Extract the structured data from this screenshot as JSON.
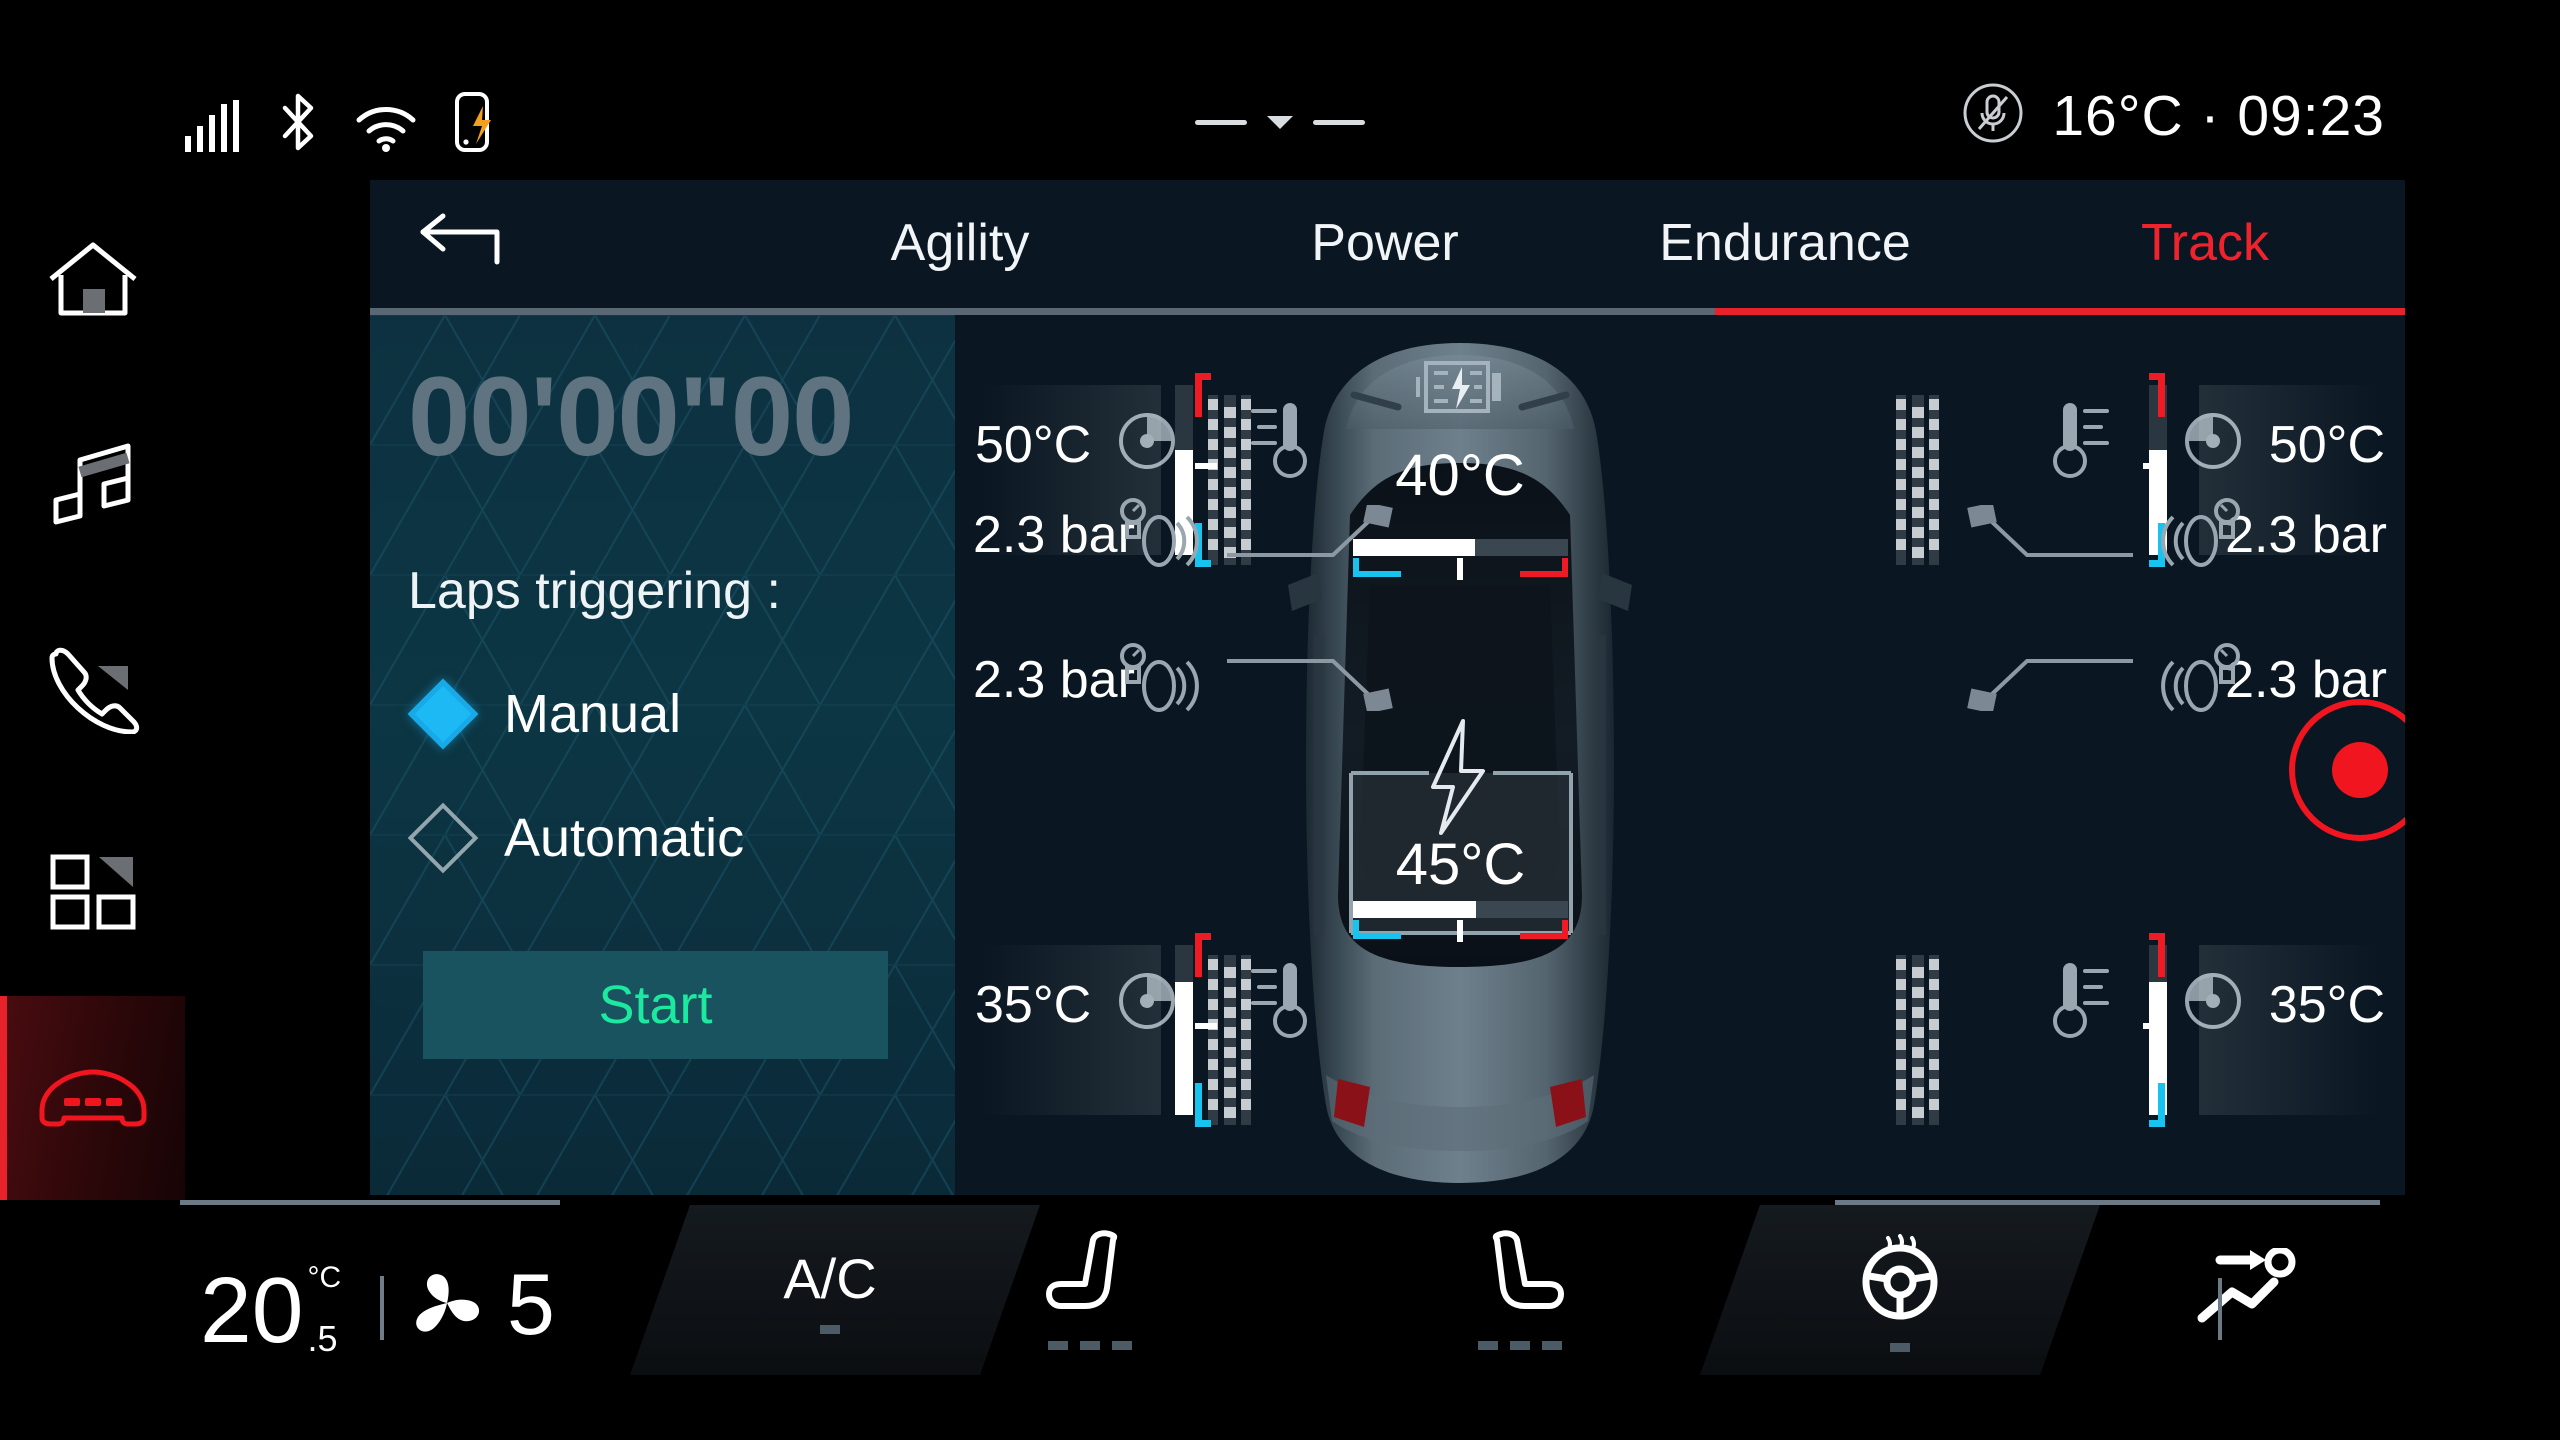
{
  "status_bar": {
    "icons_left": [
      "signal-bars-icon",
      "bluetooth-icon",
      "wifi-icon",
      "phone-charging-icon"
    ],
    "center_handle": "drag-handle",
    "mic_icon": "microphone-muted-icon",
    "outside_temp": "16°C",
    "separator": "·",
    "clock": "09:23",
    "info_text": "16°C · 09:23"
  },
  "sidebar": {
    "items": [
      {
        "name": "home",
        "icon": "home-icon",
        "active": false
      },
      {
        "name": "media",
        "icon": "music-note-icon",
        "active": false
      },
      {
        "name": "phone",
        "icon": "phone-handset-icon",
        "active": false
      },
      {
        "name": "apps",
        "icon": "apps-grid-icon",
        "active": false
      },
      {
        "name": "vehicle",
        "icon": "car-icon",
        "active": true
      }
    ]
  },
  "header": {
    "back_icon": "back-arrow-icon",
    "tabs": [
      {
        "label": "Agility",
        "active": false
      },
      {
        "label": "Power",
        "active": false
      },
      {
        "label": "Endurance",
        "active": false
      },
      {
        "label": "Track",
        "active": true
      }
    ],
    "active_tab": "Track",
    "accent_color": "#e8222a",
    "underline_inactive_color": "#5a6775"
  },
  "timer_panel": {
    "lap_time": "00'00\"00",
    "laps_label": "Laps triggering :",
    "options": [
      {
        "label": "Manual",
        "selected": true
      },
      {
        "label": "Automatic",
        "selected": false
      }
    ],
    "start_button": "Start",
    "selected_color": "#1cb9f5",
    "start_text_color": "#1ce8a0",
    "panel_color": "#0d3140"
  },
  "vehicle": {
    "corners": [
      {
        "position": "front-left",
        "brake_temp": "50°C",
        "tire_pressure": "2.3 bar",
        "gauge_fill_pct": 62
      },
      {
        "position": "front-right",
        "brake_temp": "50°C",
        "tire_pressure": "2.3 bar",
        "gauge_fill_pct": 62
      },
      {
        "position": "rear-left",
        "brake_temp": "35°C",
        "tire_pressure": "2.3 bar",
        "gauge_fill_pct": 78
      },
      {
        "position": "rear-right",
        "brake_temp": "35°C",
        "tire_pressure": "2.3 bar",
        "gauge_fill_pct": 78
      }
    ],
    "modules": [
      {
        "name": "front-charger",
        "icon": "battery-charger-icon",
        "temp": "40°C",
        "gauge_fill_pct": 57
      },
      {
        "name": "rear-battery",
        "icon": "battery-bolt-icon",
        "temp": "45°C",
        "gauge_fill_pct": 57
      }
    ],
    "icons": {
      "brake": "brake-disc-icon",
      "thermometer": "thermometer-icon",
      "tpms": "tire-pressure-sensor-icon",
      "tread": "tire-tread-icon"
    },
    "marker_hot_color": "#ef1b24",
    "marker_cold_color": "#17c4ef"
  },
  "record_button": {
    "name": "record-lap-button",
    "color": "#f0151f"
  },
  "climate": {
    "temperature": "20",
    "temperature_unit": "°C",
    "temperature_decimal": ".5",
    "fan_icon": "fan-icon",
    "fan_speed": "5",
    "ac_label": "A/C",
    "buttons": [
      {
        "name": "heated-seat-left",
        "icon": "seat-heater-left-icon",
        "levels": 3
      },
      {
        "name": "heated-seat-right",
        "icon": "seat-heater-right-icon",
        "levels": 3
      },
      {
        "name": "heated-steering",
        "icon": "steering-wheel-heat-icon",
        "levels": 1
      },
      {
        "name": "airflow-direction",
        "icon": "airflow-person-icon",
        "levels": 0
      }
    ]
  }
}
